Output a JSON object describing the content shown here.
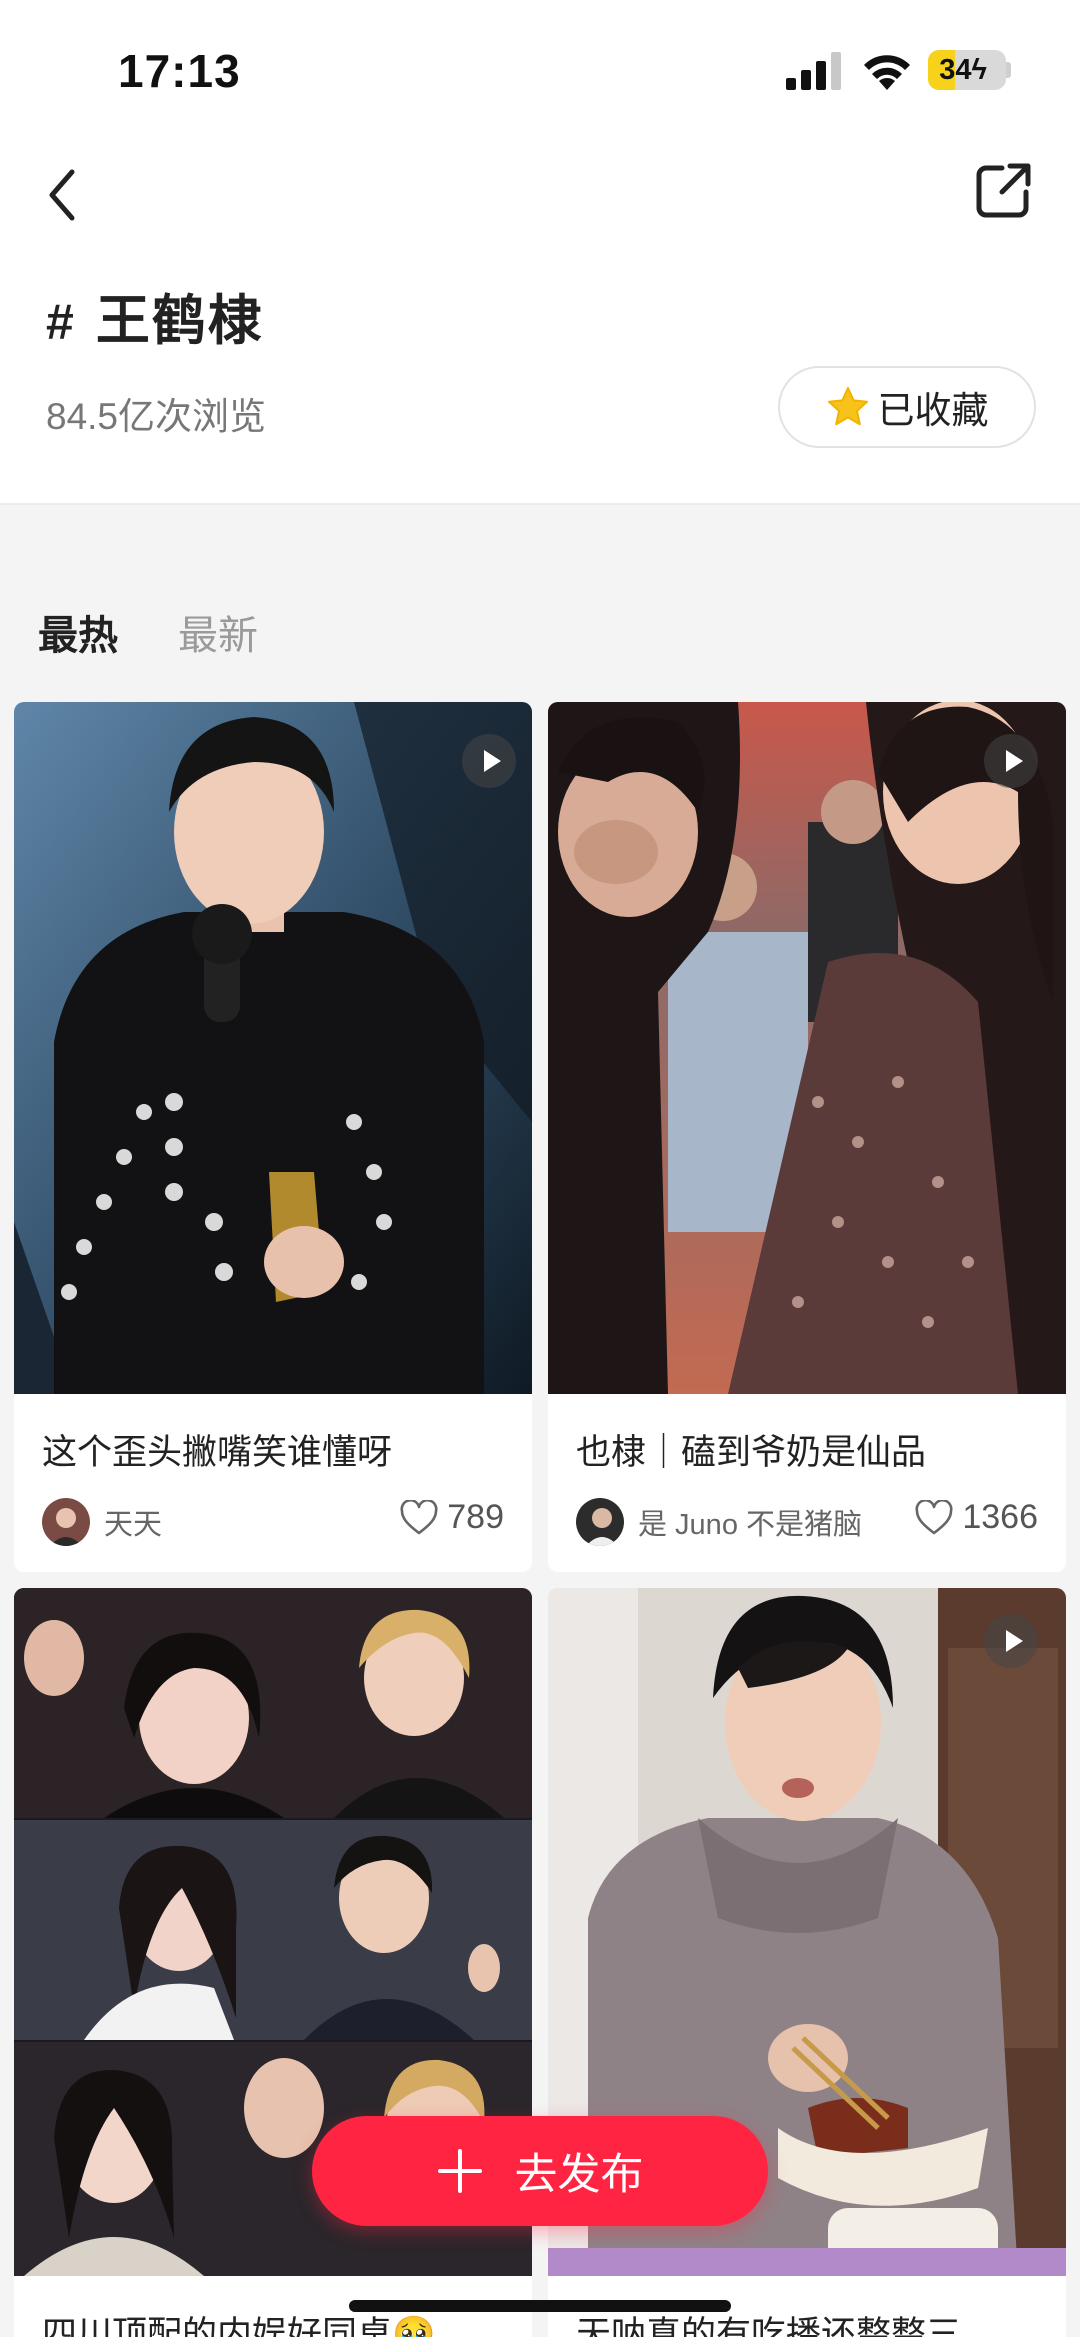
{
  "status_bar": {
    "time": "17:13",
    "battery_text": "34",
    "battery_level": 0.34
  },
  "header": {
    "back_icon": "chevron-left-icon",
    "share_icon": "share-external-icon",
    "hash": "#",
    "title": "王鹤棣",
    "views": "84.5亿次浏览",
    "favorite_label": "已收藏",
    "favorite_icon_color": "#f7c21a"
  },
  "tabs": [
    {
      "label": "最热",
      "active": true
    },
    {
      "label": "最新",
      "active": false
    }
  ],
  "feed": [
    {
      "title": "这个歪头撇嘴笑谁懂呀",
      "author": "天天",
      "likes": "789",
      "video": true
    },
    {
      "title": "也棣｜磕到爷奶是仙品",
      "author": "是 Juno 不是猪脑",
      "likes": "1366",
      "video": true
    },
    {
      "title": "四川顶配的内娱好同桌🥹",
      "author": "",
      "likes": "",
      "video": false
    },
    {
      "title": "天呐真的有吃播还整整三",
      "author": "",
      "likes": "",
      "video": true
    }
  ],
  "publish": {
    "label": "去发布",
    "color": "#ff2442"
  }
}
